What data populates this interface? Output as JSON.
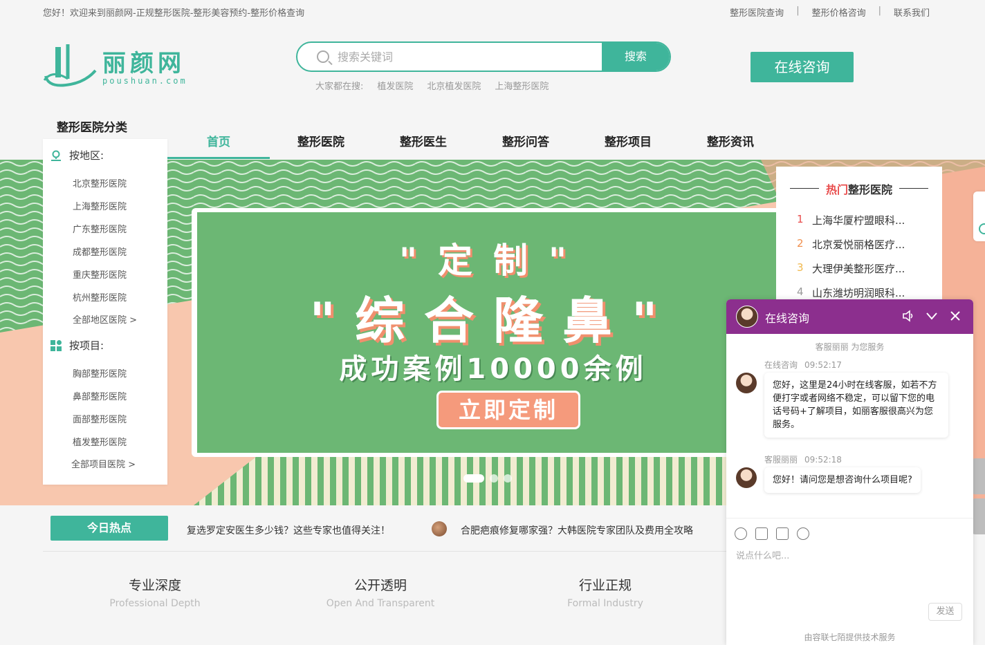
{
  "topbar": {
    "welcome": "您好！欢迎来到丽颜网-正规整形医院-整形美容预约-整形价格查询",
    "links": [
      "整形医院查询",
      "整形价格咨询",
      "联系我们"
    ],
    "separator": "|"
  },
  "logo": {
    "brand": "丽颜网",
    "domain": "poushuan.com"
  },
  "search": {
    "placeholder": "搜索关键词",
    "button": "搜索",
    "hot_label": "大家都在搜:",
    "hot_terms": [
      "植发医院",
      "北京植发医院",
      "上海整形医院"
    ]
  },
  "header": {
    "consult_button": "在线咨询"
  },
  "category_title": "整形医院分类",
  "nav": [
    "首页",
    "整形医院",
    "整形医生",
    "整形问答",
    "整形项目",
    "整形资讯"
  ],
  "sidebar": {
    "region_title": "按地区:",
    "regions": [
      "北京整形医院",
      "上海整形医院",
      "广东整形医院",
      "成都整形医院",
      "重庆整形医院",
      "杭州整形医院",
      "全部地区医院 >"
    ],
    "project_title": "按项目:",
    "projects": [
      "胸部整形医院",
      "鼻部整形医院",
      "面部整形医院",
      "植发整形医院",
      "全部项目医院 >"
    ]
  },
  "banner": {
    "line1": "\"定制\"",
    "line2": "\"综合隆鼻\"",
    "line3": "成功案例10000余例",
    "cta": "立即定制",
    "slides": 3,
    "active_slide": 1
  },
  "hot_hospitals": {
    "title_red": "热门",
    "title_rest": "整形医院",
    "items": [
      {
        "rank": "1",
        "name": "上海华厦柠盟眼科..."
      },
      {
        "rank": "2",
        "name": "北京爱悦丽格医疗..."
      },
      {
        "rank": "3",
        "name": "大理伊美整形医疗..."
      },
      {
        "rank": "4",
        "name": "山东潍坊明润眼科..."
      }
    ]
  },
  "today": {
    "tag": "今日热点",
    "news1": "复选罗定安医生多少钱？这些专家也值得关注！",
    "news2": "合肥疤痕修复哪家强？大韩医院专家团队及费用全攻略"
  },
  "features": [
    {
      "cn": "专业深度",
      "en": "Professional Depth"
    },
    {
      "cn": "公开透明",
      "en": "Open And Transparent"
    },
    {
      "cn": "行业正规",
      "en": "Formal Industry"
    }
  ],
  "chat": {
    "title": "在线咨询",
    "service_line": "客服丽丽 为您服务",
    "messages": [
      {
        "sender": "在线咨询",
        "time": "09:52:17",
        "text": "您好，这里是24小时在线客服，如若不方便打字或者网络不稳定，可以留下您的电话号码+了解项目，如丽客服很高兴为您服务。"
      },
      {
        "sender": "客服丽丽",
        "time": "09:52:18",
        "text": "您好！请问您是想咨询什么项目呢?"
      }
    ],
    "input_placeholder": "说点什么吧...",
    "send": "发送",
    "powered": "由容联七陌提供技术服务",
    "colors": {
      "header": "#8c2f8e"
    }
  },
  "colors": {
    "accent": "#3fb59b",
    "banner_green": "#6cb774",
    "banner_peach": "#f8c7ae",
    "hot_red": "#e84c4c"
  }
}
